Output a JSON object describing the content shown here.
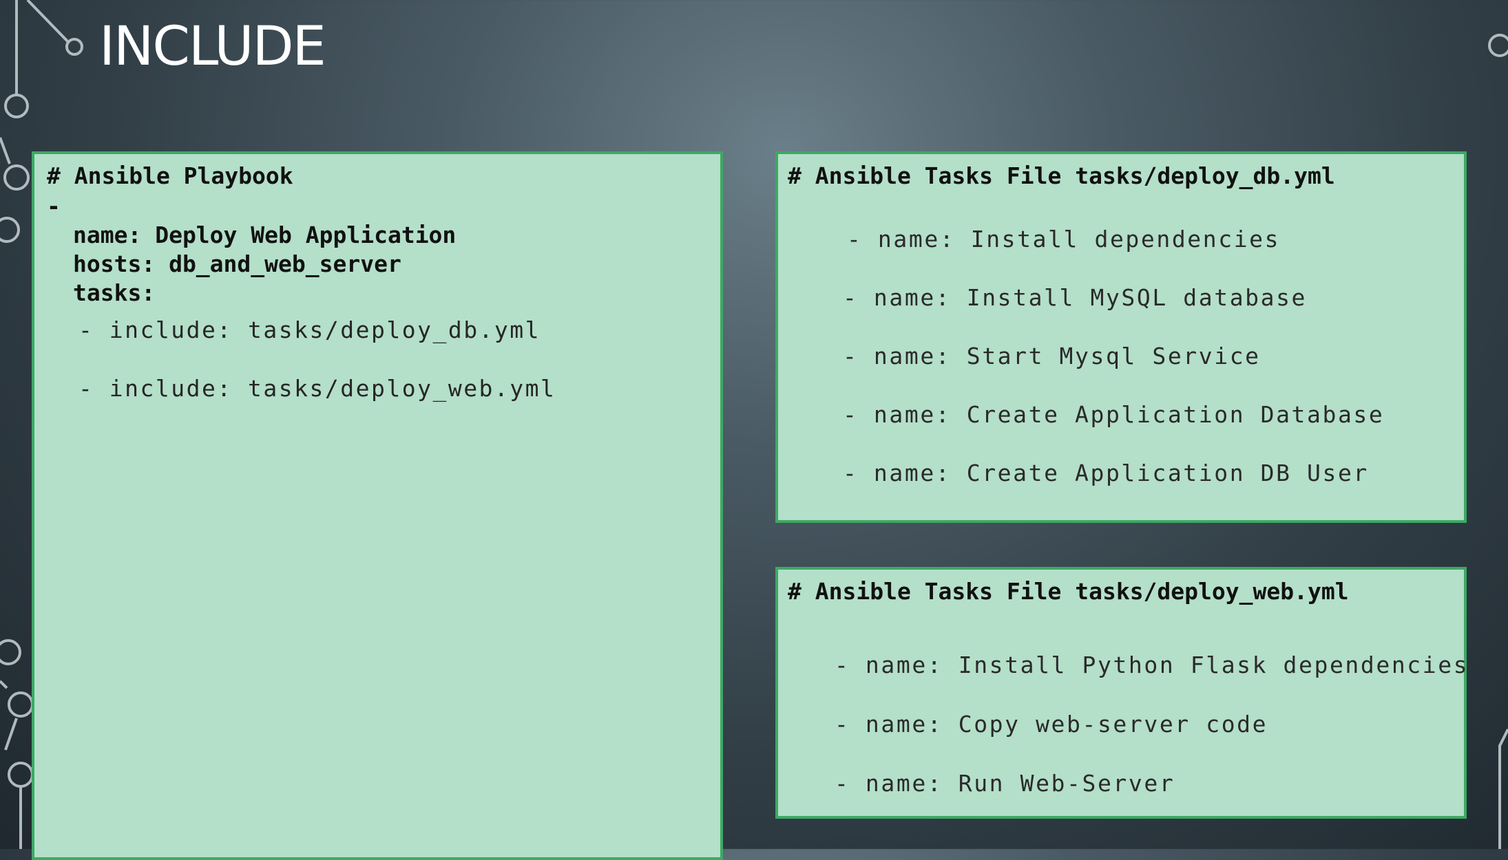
{
  "slide": {
    "title": "INCLUDE"
  },
  "playbook": {
    "comment": "# Ansible Playbook",
    "dash": "-",
    "name_line": "name: Deploy Web Application",
    "hosts_line": "hosts: db_and_web_server",
    "tasks_line": "tasks:",
    "includes": [
      "- include: tasks/deploy_db.yml",
      "- include: tasks/deploy_web.yml"
    ]
  },
  "deploy_db": {
    "comment": "# Ansible Tasks File tasks/deploy_db.yml",
    "tasks": [
      "- name: Install dependencies",
      "- name: Install MySQL database",
      "- name: Start Mysql Service",
      "- name: Create Application Database",
      "- name: Create Application DB User"
    ]
  },
  "deploy_web": {
    "comment": "# Ansible Tasks File tasks/deploy_web.yml",
    "tasks": [
      "- name: Install Python Flask dependencies",
      "- name: Copy web-server code",
      "- name: Run Web-Server"
    ]
  },
  "colors": {
    "panel_fill": "#b4dfc9",
    "panel_border": "#3ea864",
    "title_text": "#ffffff",
    "background": "#3a4750"
  }
}
